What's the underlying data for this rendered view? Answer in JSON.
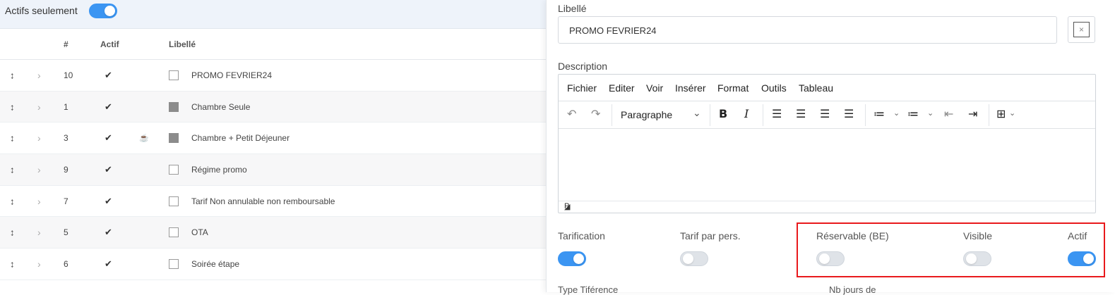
{
  "filter": {
    "label": "Actifs seulement",
    "active": true
  },
  "table": {
    "headers": {
      "num": "#",
      "actif": "Actif",
      "libelle": "Libellé"
    },
    "rows": [
      {
        "num": "10",
        "check": "✔",
        "icon": "",
        "box": "empty",
        "label": "PROMO FEVRIER24"
      },
      {
        "num": "1",
        "check": "✔",
        "icon": "",
        "box": "filled",
        "label": "Chambre Seule"
      },
      {
        "num": "3",
        "check": "✔",
        "icon": "☕",
        "box": "filled",
        "label": "Chambre + Petit Déjeuner"
      },
      {
        "num": "9",
        "check": "✔",
        "icon": "",
        "box": "empty",
        "label": "Régime promo"
      },
      {
        "num": "7",
        "check": "✔",
        "icon": "",
        "box": "empty",
        "label": "Tarif Non annulable non remboursable"
      },
      {
        "num": "5",
        "check": "✔",
        "icon": "",
        "box": "empty",
        "label": "OTA"
      },
      {
        "num": "6",
        "check": "✔",
        "icon": "",
        "box": "empty",
        "label": "Soirée étape"
      }
    ]
  },
  "panel": {
    "libelle_label": "Libellé",
    "libelle_value": "PROMO FEVRIER24",
    "close_symbol": "×",
    "description_label": "Description",
    "menu": [
      "Fichier",
      "Editer",
      "Voir",
      "Insérer",
      "Format",
      "Outils",
      "Tableau"
    ],
    "toolbar": {
      "block_format": "Paragraphe"
    },
    "statusbar": "P",
    "toggles": [
      {
        "label": "Tarification",
        "on": true
      },
      {
        "label": "Tarif par pers.",
        "on": false
      },
      {
        "label": "Réservable (BE)",
        "on": false
      },
      {
        "label": "Visible",
        "on": false
      },
      {
        "label": "Actif",
        "on": true
      }
    ],
    "bottom_labels": [
      "Type Tiférence",
      "Nb jours de"
    ]
  },
  "colors": {
    "accent": "#3b95f2",
    "highlight": "#e8191c"
  }
}
